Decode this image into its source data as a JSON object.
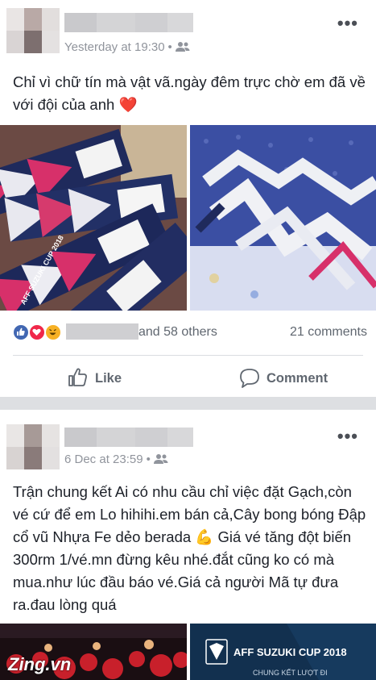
{
  "posts": [
    {
      "timestamp": "Yesterday at 19:30",
      "privacy_icon": "friends-icon",
      "text": "Chỉ vì chữ tín mà vật vã.ngày đêm trực chờ em đã về với đội của anh",
      "emoji": "❤️",
      "reactions": {
        "icons": [
          "like-icon",
          "love-icon",
          "haha-icon"
        ],
        "others_label": "and 58 others",
        "comments_label": "21 comments"
      },
      "actions": {
        "like_label": "Like",
        "comment_label": "Comment"
      },
      "photo_texts": {
        "ticket_brand": "AFF SUZUKI CUP 2018"
      }
    },
    {
      "timestamp": "6 Dec at 23:59",
      "privacy_icon": "friends-icon",
      "text": "Trận chung kết Ai có nhu cầu chỉ việc đặt Gạch,còn vé cứ để em Lo hihihi.em bán cả,Cây bong bóng Đập cổ vũ Nhựa Fe dẻo berada 💪 Giá vé tăng đột biến 300rm 1/vé.mn đừng kêu nhé.đắt cũng ko có mà mua.như lúc đầu báo vé.Giá cả người Mã tự đưa ra.đau lòng quá",
      "photo_texts": {
        "watermark": "Zing.vn",
        "banner_title": "AFF SUZUKI CUP 2018",
        "banner_subtitle": "CHUNG KẾT LƯỢT ĐI"
      }
    }
  ],
  "colors": {
    "like_blue": "#4267b2",
    "love_red": "#f0284a",
    "haha_yellow": "#f7b125",
    "muted_text": "#90949c"
  }
}
